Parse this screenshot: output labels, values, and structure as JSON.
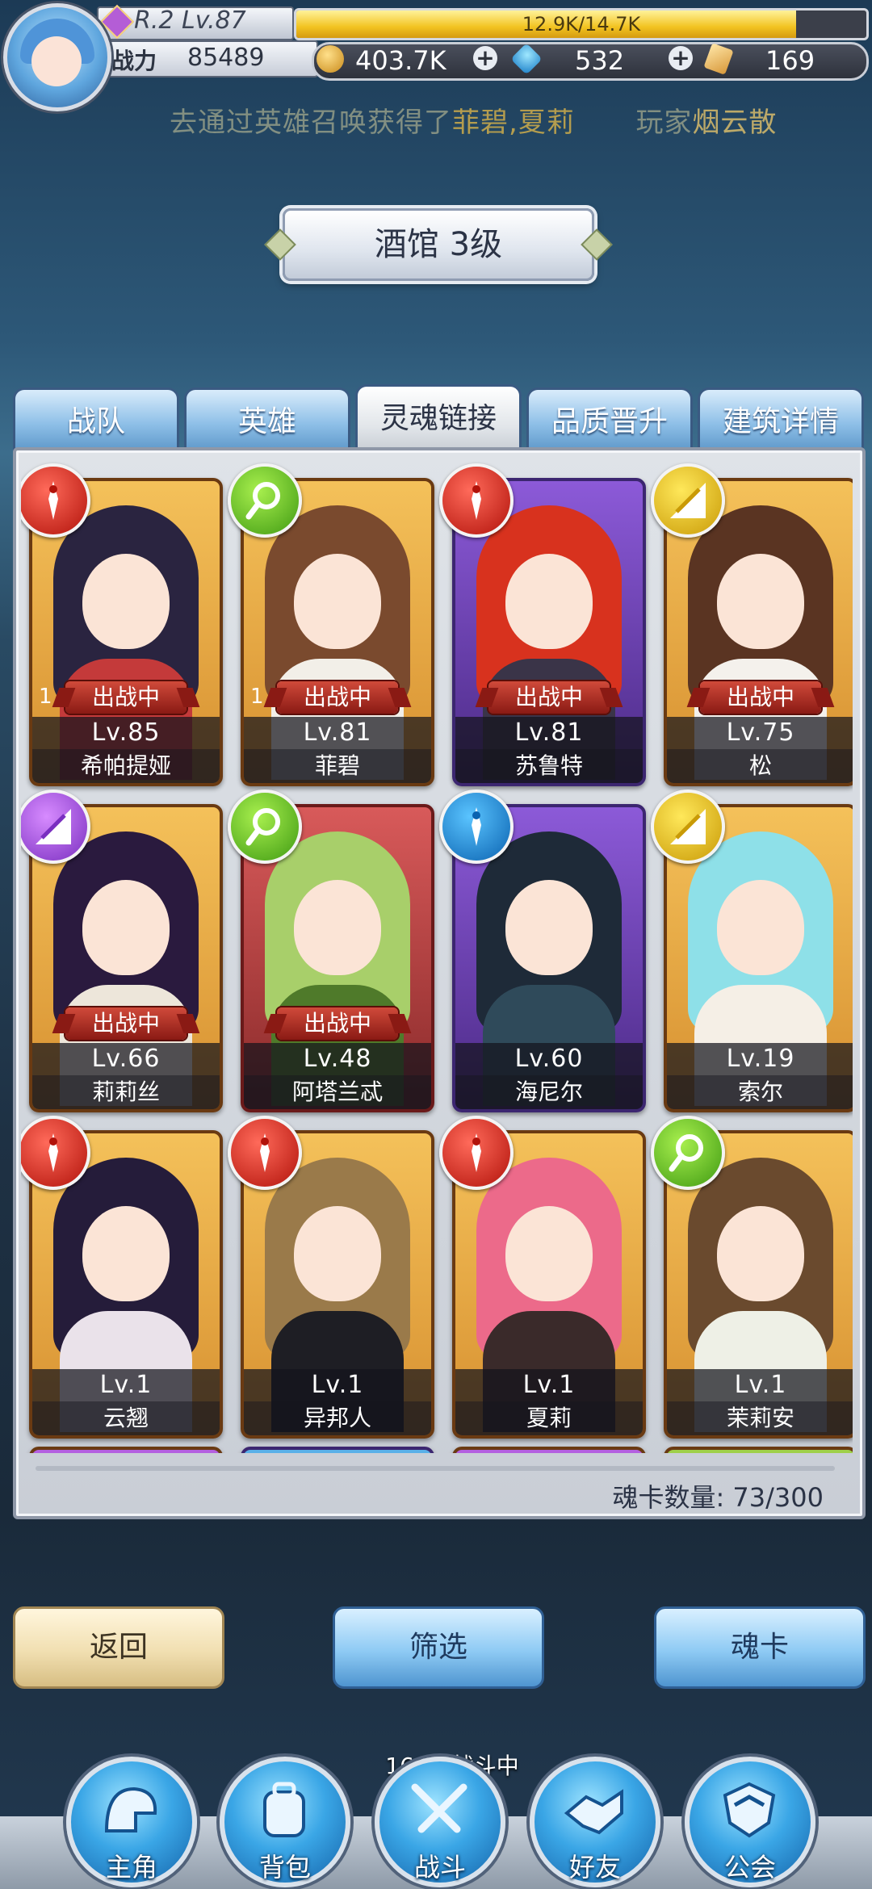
{
  "player": {
    "rank_level": "R.2 Lv.87",
    "xp_text": "12.9K/14.7K",
    "xp_fraction": 0.877,
    "power_label": "战力",
    "power_value": "85489"
  },
  "currencies": {
    "gold": "403.7K",
    "gems": "532",
    "tickets": "169",
    "plus_symbol": "+"
  },
  "ticker": {
    "prefix": "去通过英雄召唤获得了",
    "heroes": "菲碧,夏莉",
    "player_label": "玩家",
    "player_name": "烟云散"
  },
  "building": {
    "title": "酒馆 3级"
  },
  "tabs": [
    {
      "label": "战队"
    },
    {
      "label": "英雄"
    },
    {
      "label": "灵魂链接"
    },
    {
      "label": "品质晋升"
    },
    {
      "label": "建筑详情"
    }
  ],
  "deploy_badge": "出战中",
  "heroes": [
    {
      "name": "希帕提娅",
      "level": "Lv.85",
      "deployed": true,
      "count": "1",
      "element": "red",
      "frame": "gold",
      "hair": "#2a2440",
      "outfit": "#c43a3a"
    },
    {
      "name": "菲碧",
      "level": "Lv.81",
      "deployed": true,
      "count": "1",
      "element": "green",
      "frame": "gold",
      "hair": "#7a4a2e",
      "outfit": "#f2efe8"
    },
    {
      "name": "苏鲁特",
      "level": "Lv.81",
      "deployed": true,
      "element": "red",
      "frame": "purple",
      "hair": "#d8321e",
      "outfit": "#3a3448"
    },
    {
      "name": "松",
      "level": "Lv.75",
      "deployed": true,
      "element": "yellow",
      "frame": "gold",
      "hair": "#5a3422",
      "outfit": "#f4f1ec"
    },
    {
      "name": "莉莉丝",
      "level": "Lv.66",
      "deployed": true,
      "element": "purple",
      "frame": "gold",
      "hair": "#2a1a3e",
      "outfit": "#ede6da"
    },
    {
      "name": "阿塔兰忒",
      "level": "Lv.48",
      "deployed": true,
      "element": "green",
      "frame": "red",
      "hair": "#a8cf6a",
      "outfit": "#4f7a2a"
    },
    {
      "name": "海尼尔",
      "level": "Lv.60",
      "deployed": false,
      "element": "blue",
      "frame": "purple",
      "hair": "#1e2a38",
      "outfit": "#2f4a5a"
    },
    {
      "name": "索尔",
      "level": "Lv.19",
      "deployed": false,
      "element": "yellow",
      "frame": "gold",
      "hair": "#8ee0e8",
      "outfit": "#f5efe6"
    },
    {
      "name": "云翘",
      "level": "Lv.1",
      "deployed": false,
      "element": "red",
      "frame": "gold",
      "hair": "#251c3a",
      "outfit": "#eae2ea"
    },
    {
      "name": "异邦人",
      "level": "Lv.1",
      "deployed": false,
      "element": "red",
      "frame": "gold",
      "hair": "#9a7a4a",
      "outfit": "#1e1e24"
    },
    {
      "name": "夏莉",
      "level": "Lv.1",
      "deployed": false,
      "element": "red",
      "frame": "gold",
      "hair": "#ec6a8a",
      "outfit": "#3a2a2a"
    },
    {
      "name": "茉莉安",
      "level": "Lv.1",
      "deployed": false,
      "element": "green",
      "frame": "gold",
      "hair": "#6a4a2e",
      "outfit": "#eef0e6"
    }
  ],
  "soul_cards": {
    "label": "魂卡数量:",
    "value": "73/300"
  },
  "buttons": {
    "back": "返回",
    "filter": "筛选",
    "soul_card": "魂卡"
  },
  "battle_status": "162层战斗中",
  "nav": [
    {
      "label": "主角",
      "icon": "helmet-icon"
    },
    {
      "label": "背包",
      "icon": "backpack-icon"
    },
    {
      "label": "战斗",
      "icon": "crossed-swords-icon"
    },
    {
      "label": "好友",
      "icon": "handshake-icon"
    },
    {
      "label": "公会",
      "icon": "guild-crest-icon"
    }
  ]
}
